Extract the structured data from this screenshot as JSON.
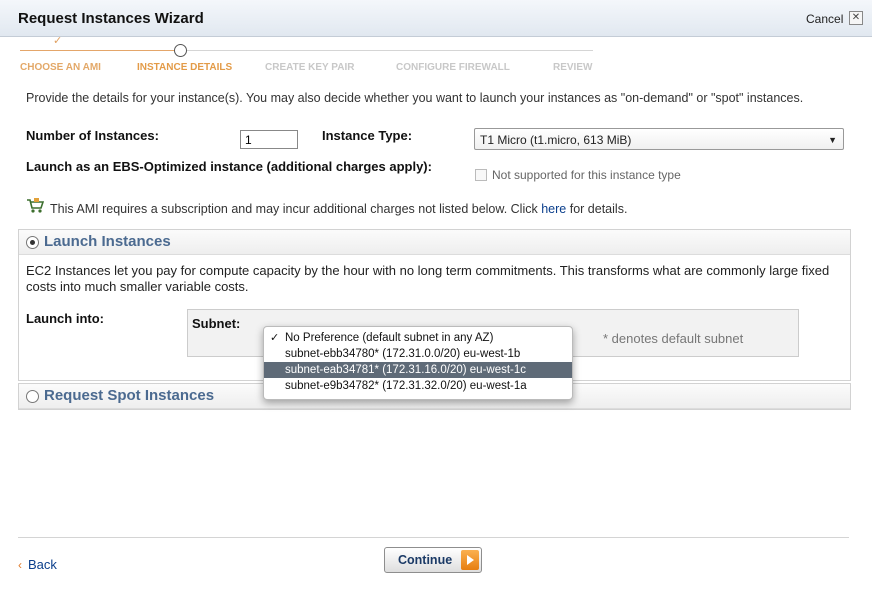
{
  "dialog": {
    "title": "Request Instances Wizard",
    "cancel_label": "Cancel",
    "close_glyph": "✕"
  },
  "wizard": {
    "steps": [
      {
        "label": "CHOOSE AN AMI",
        "state": "done"
      },
      {
        "label": "INSTANCE DETAILS",
        "state": "active"
      },
      {
        "label": "CREATE KEY PAIR",
        "state": "pending"
      },
      {
        "label": "CONFIGURE FIREWALL",
        "state": "pending"
      },
      {
        "label": "REVIEW",
        "state": "pending"
      }
    ],
    "done_mark": "✓"
  },
  "form": {
    "intro": "Provide the details for your instance(s). You may also decide whether you want to launch your instances as \"on-demand\" or \"spot\" instances.",
    "num_instances_label": "Number of Instances:",
    "num_instances_value": "1",
    "instance_type_label": "Instance Type:",
    "instance_type_value": "T1 Micro (t1.micro, 613 MiB)",
    "ebs_label": "Launch as an EBS-Optimized instance (additional charges apply):",
    "ebs_checkbox_label": "Not supported for this instance type",
    "ebs_checked": false,
    "subscription_note": "This AMI requires a subscription and may incur additional charges not listed below. Click",
    "subscription_link": "here",
    "subscription_suffix": "for details."
  },
  "launch_panel": {
    "title": "Launch Instances",
    "selected": true,
    "description": "EC2 Instances let you pay for compute capacity by the hour with no long term commitments. This transforms what are commonly large fixed costs into much smaller variable costs.",
    "launch_into_label": "Launch into:",
    "subnet_label": "Subnet:",
    "denote_note": "* denotes default subnet"
  },
  "subnet_dropdown": {
    "options": [
      {
        "label": "No Preference (default subnet in any AZ)",
        "checked": true,
        "highlighted": false
      },
      {
        "label": "subnet-ebb34780* (172.31.0.0/20) eu-west-1b",
        "checked": false,
        "highlighted": false
      },
      {
        "label": "subnet-eab34781* (172.31.16.0/20) eu-west-1c",
        "checked": false,
        "highlighted": true
      },
      {
        "label": "subnet-e9b34782* (172.31.32.0/20) eu-west-1a",
        "checked": false,
        "highlighted": false
      }
    ]
  },
  "spot_panel": {
    "title": "Request Spot Instances",
    "selected": false
  },
  "footer": {
    "back_label": "Back",
    "continue_label": "Continue"
  },
  "icons": {
    "cart": "cart-icon",
    "dropdown_arrow": "▼"
  }
}
